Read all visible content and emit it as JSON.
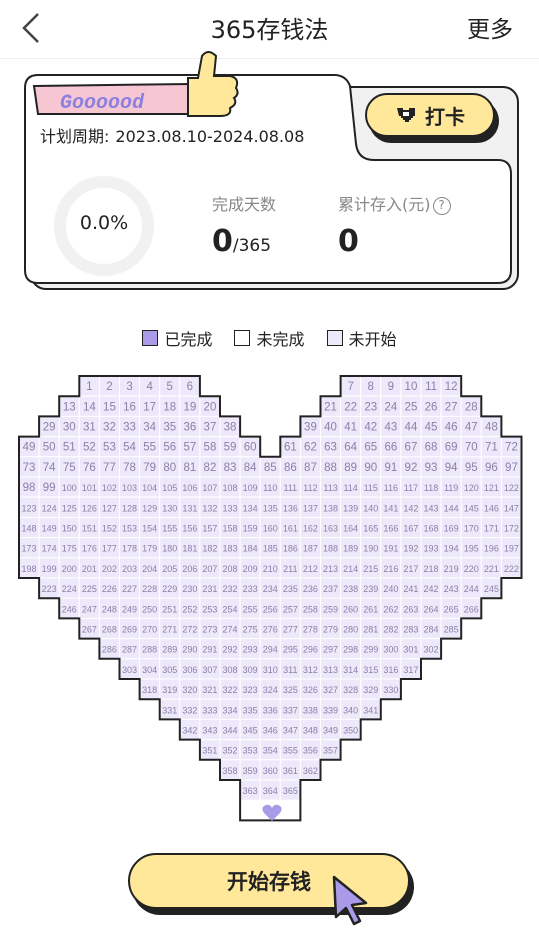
{
  "header": {
    "title": "365存钱法",
    "more_label": "更多"
  },
  "card": {
    "badge_text": "Goooood",
    "period_label": "计划周期:",
    "period_value": "2023.08.10-2024.08.08",
    "checkin_label": "打卡",
    "progress_percent": "0.0%",
    "days_label": "完成天数",
    "days_value": "0",
    "days_total": "365",
    "saved_label": "累计存入(元)",
    "help_symbol": "?",
    "saved_value": "0"
  },
  "legend": [
    {
      "label": "已完成",
      "color": "#a99be8"
    },
    {
      "label": "未完成",
      "color": "#ffffff"
    },
    {
      "label": "未开始",
      "color": "#ede9fb"
    }
  ],
  "grid": {
    "rows": [
      [
        3,
        [
          1,
          2,
          3,
          4,
          5,
          6
        ]
      ],
      [
        2,
        [
          13,
          14,
          15,
          16,
          17,
          18,
          19,
          20
        ]
      ],
      [
        1,
        [
          29,
          30,
          31,
          32,
          33,
          34,
          35,
          36,
          37,
          38
        ]
      ],
      [
        0,
        [
          49,
          50,
          51,
          52,
          53,
          54,
          55,
          56,
          57,
          58,
          59,
          60
        ]
      ],
      [
        0,
        [
          73,
          74,
          75,
          76,
          77,
          78,
          79,
          80,
          81,
          82,
          83,
          84,
          85,
          86,
          87,
          88,
          89,
          90,
          91,
          92,
          93,
          94,
          95,
          96,
          97
        ]
      ],
      [
        0,
        [
          98,
          99,
          100,
          101,
          102,
          103,
          104,
          105,
          106,
          107,
          108,
          109,
          110,
          111,
          112,
          113,
          114,
          115,
          116,
          117,
          118,
          119,
          120,
          121,
          122
        ]
      ],
      [
        0,
        [
          123,
          124,
          125,
          126,
          127,
          128,
          129,
          130,
          131,
          132,
          133,
          134,
          135,
          136,
          137,
          138,
          139,
          140,
          141,
          142,
          143,
          144,
          145,
          146,
          147
        ]
      ],
      [
        0,
        [
          148,
          149,
          150,
          151,
          152,
          153,
          154,
          155,
          156,
          157,
          158,
          159,
          160,
          161,
          162,
          163,
          164,
          165,
          166,
          167,
          168,
          169,
          170,
          171,
          172
        ]
      ],
      [
        0,
        [
          173,
          174,
          175,
          176,
          177,
          178,
          179,
          180,
          181,
          182,
          183,
          184,
          185,
          186,
          187,
          188,
          189,
          190,
          191,
          192,
          193,
          194,
          195,
          196,
          197
        ]
      ],
      [
        0,
        [
          198,
          199,
          200,
          201,
          202,
          203,
          204,
          205,
          206,
          207,
          208,
          209,
          210,
          211,
          212,
          213,
          214,
          215,
          216,
          217,
          218,
          219,
          220,
          221,
          222
        ]
      ],
      [
        1,
        [
          223,
          224,
          225,
          226,
          227,
          228,
          229,
          230,
          231,
          232,
          233,
          234,
          235,
          236,
          237,
          238,
          239,
          240,
          241,
          242,
          243,
          244,
          245
        ]
      ],
      [
        2,
        [
          246,
          247,
          248,
          249,
          250,
          251,
          252,
          253,
          254,
          255,
          256,
          257,
          258,
          259,
          260,
          261,
          262,
          263,
          264,
          265,
          266
        ]
      ],
      [
        3,
        [
          267,
          268,
          269,
          270,
          271,
          272,
          273,
          274,
          275,
          276,
          277,
          278,
          279,
          280,
          281,
          282,
          283,
          284,
          285
        ]
      ],
      [
        4,
        [
          286,
          287,
          288,
          289,
          290,
          291,
          292,
          293,
          294,
          295,
          296,
          297,
          298,
          299,
          300,
          301,
          302
        ]
      ],
      [
        5,
        [
          303,
          304,
          305,
          306,
          307,
          308,
          309,
          310,
          311,
          312,
          313,
          314,
          315,
          316,
          317
        ]
      ],
      [
        6,
        [
          318,
          319,
          320,
          321,
          322,
          323,
          324,
          325,
          326,
          327,
          328,
          329,
          330
        ]
      ],
      [
        7,
        [
          331,
          332,
          333,
          334,
          335,
          336,
          337,
          338,
          339,
          340,
          341
        ]
      ],
      [
        8,
        [
          342,
          343,
          344,
          345,
          346,
          347,
          348,
          349,
          350
        ]
      ],
      [
        9,
        [
          351,
          352,
          353,
          354,
          355,
          356,
          357
        ]
      ],
      [
        10,
        [
          358,
          359,
          360,
          361,
          362
        ]
      ],
      [
        11,
        [
          363,
          364,
          365
        ]
      ]
    ],
    "right_lobe": [
      [
        16,
        [
          7,
          8,
          9,
          10,
          11,
          12
        ]
      ],
      [
        15,
        [
          21,
          22,
          23,
          24,
          25,
          26,
          27,
          28
        ]
      ],
      [
        14,
        [
          39,
          40,
          41,
          42,
          43,
          44,
          45,
          46,
          47,
          48
        ]
      ],
      [
        13,
        [
          61,
          62,
          63,
          64,
          65,
          66,
          67,
          68,
          69,
          70,
          71,
          72
        ]
      ]
    ]
  },
  "start_button_label": "开始存钱"
}
